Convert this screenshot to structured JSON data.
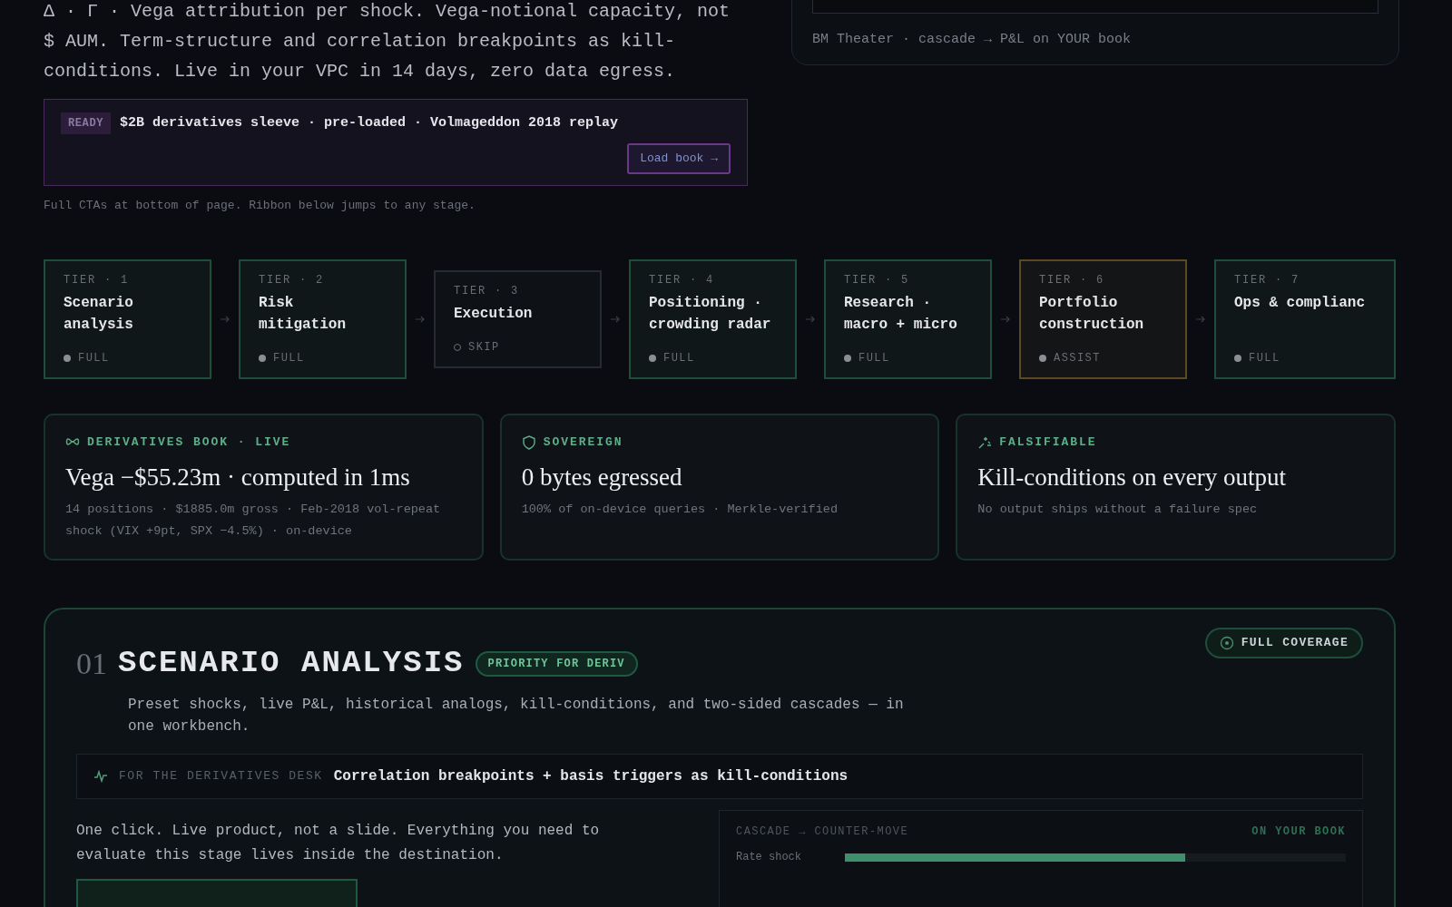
{
  "intro": {
    "text": "Δ · Γ · Vega attribution per shock. Vega-notional capacity, not $ AUM. Term-structure and correlation breakpoints as kill-conditions. Live in your VPC in 14 days, zero data egress."
  },
  "ready": {
    "badge": "READY",
    "text": "$2B derivatives sleeve · pre-loaded · Volmageddon 2018 replay",
    "button": "Load book →"
  },
  "caption": "Full CTAs at bottom of page. Ribbon below jumps to any stage.",
  "theater": {
    "caption": "BM Theater · cascade → P&L on YOUR book"
  },
  "tiers": [
    {
      "tier": "TIER · 1",
      "title": "Scenario analysis",
      "status": "FULL",
      "kind": "full"
    },
    {
      "tier": "TIER · 2",
      "title": "Risk mitigation",
      "status": "FULL",
      "kind": "full"
    },
    {
      "tier": "TIER · 3",
      "title": "Execution",
      "status": "SKIP",
      "kind": "skip"
    },
    {
      "tier": "TIER · 4",
      "title": "Positioning · crowding radar",
      "status": "FULL",
      "kind": "full"
    },
    {
      "tier": "TIER · 5",
      "title": "Research · macro + micro",
      "status": "FULL",
      "kind": "full"
    },
    {
      "tier": "TIER · 6",
      "title": "Portfolio construction",
      "status": "ASSIST",
      "kind": "assist"
    },
    {
      "tier": "TIER · 7",
      "title": "Ops & complianc",
      "status": "FULL",
      "kind": "full"
    }
  ],
  "stats": [
    {
      "kind": "link",
      "label": "DERIVATIVES BOOK · LIVE",
      "headline": "Vega −$55.23m · computed in 1ms",
      "sub": "14 positions · $1885.0m gross · Feb-2018 vol-repeat shock (VIX +9pt, SPX −4.5%) · on-device"
    },
    {
      "kind": "shield",
      "label": "SOVEREIGN",
      "headline": "0 bytes egressed",
      "sub": "100% of on-device queries · Merkle-verified"
    },
    {
      "kind": "spark",
      "label": "FALSIFIABLE",
      "headline": "Kill-conditions on every output",
      "sub": "No output ships without a failure spec"
    }
  ],
  "section": {
    "number": "01",
    "title": "SCENARIO ANALYSIS",
    "badge": "PRIORITY FOR DERIV",
    "coverage": "FULL COVERAGE",
    "description": "Preset shocks, live P&L, historical analogs, kill-conditions, and two-sided cascades — in one workbench.",
    "desk_label": "FOR THE DERIVATIVES DESK",
    "desk_text": "Correlation breakpoints + basis triggers as kill-conditions",
    "body": "One click. Live product, not a slide. Everything you need to evaluate this stage lives inside the destination.",
    "panel": {
      "title": "CASCADE → COUNTER-MOVE",
      "tag": "ON YOUR BOOK",
      "bars": [
        {
          "label": "Rate shock",
          "level": 0.68
        }
      ]
    }
  }
}
